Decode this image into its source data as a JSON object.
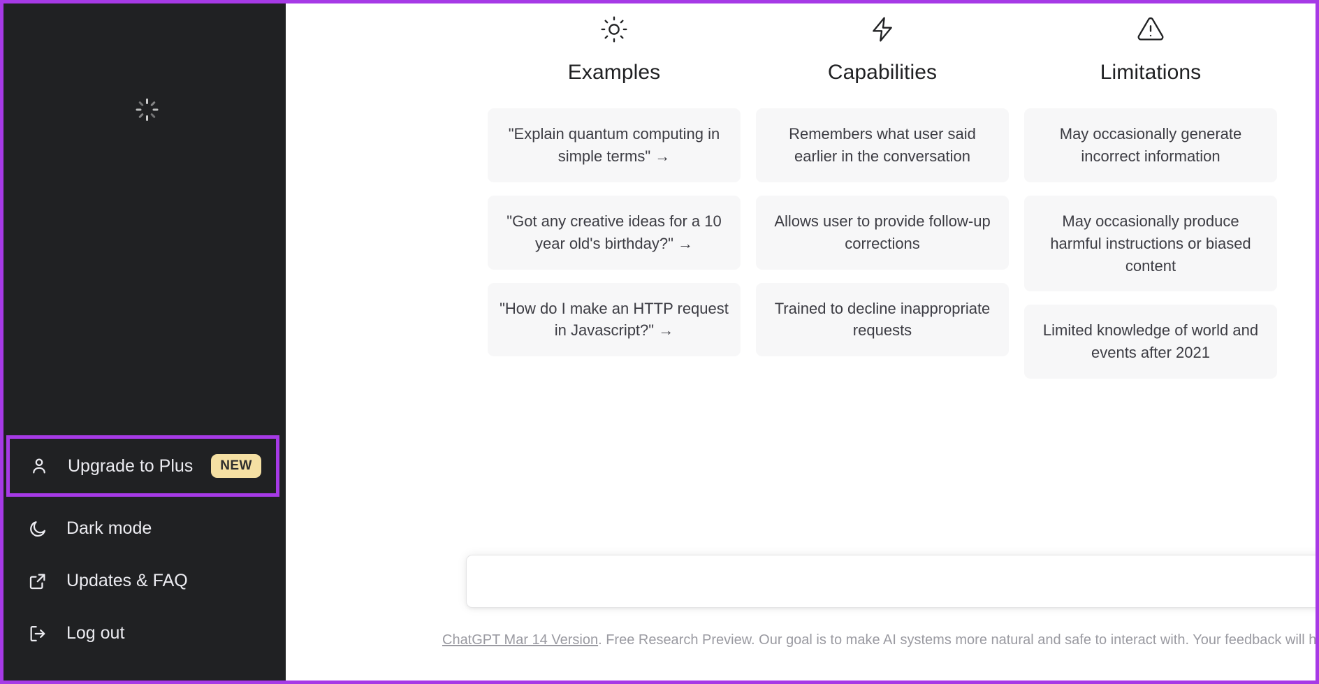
{
  "app": {
    "name": "ChatGPT",
    "highlight_color": "#a63ae6",
    "sidebar_bg": "#202123",
    "card_bg": "#f7f7f8",
    "badge_bg": "#f5e0a3"
  },
  "sidebar": {
    "status_icon": "loading-spinner-icon",
    "items": [
      {
        "id": "upgrade-to-plus",
        "label": "Upgrade to Plus",
        "icon": "person-icon",
        "badge": "NEW",
        "highlighted": true
      },
      {
        "id": "dark-mode",
        "label": "Dark mode",
        "icon": "moon-icon",
        "badge": "",
        "highlighted": false
      },
      {
        "id": "updates-faq",
        "label": "Updates & FAQ",
        "icon": "external-link-icon",
        "badge": "",
        "highlighted": false
      },
      {
        "id": "log-out",
        "label": "Log out",
        "icon": "logout-icon",
        "badge": "",
        "highlighted": false
      }
    ]
  },
  "main": {
    "columns": [
      {
        "id": "examples",
        "title": "Examples",
        "icon": "sun-icon",
        "cards": [
          "\"Explain quantum computing in simple terms\" →",
          "\"Got any creative ideas for a 10 year old's birthday?\" →",
          "\"How do I make an HTTP request in Javascript?\" →"
        ]
      },
      {
        "id": "capabilities",
        "title": "Capabilities",
        "icon": "lightning-bolt-icon",
        "cards": [
          "Remembers what user said earlier in the conversation",
          "Allows user to provide follow-up corrections",
          "Trained to decline inappropriate requests"
        ]
      },
      {
        "id": "limitations",
        "title": "Limitations",
        "icon": "warning-triangle-icon",
        "cards": [
          "May occasionally generate incorrect information",
          "May occasionally produce harmful instructions or biased content",
          "Limited knowledge of world and events after 2021"
        ]
      }
    ],
    "composer": {
      "value": "",
      "placeholder": ""
    },
    "footer": {
      "link_text": "ChatGPT Mar 14 Version",
      "rest_text": ". Free Research Preview. Our goal is to make AI systems more natural and safe to interact with. Your feedback will help us improve."
    }
  }
}
